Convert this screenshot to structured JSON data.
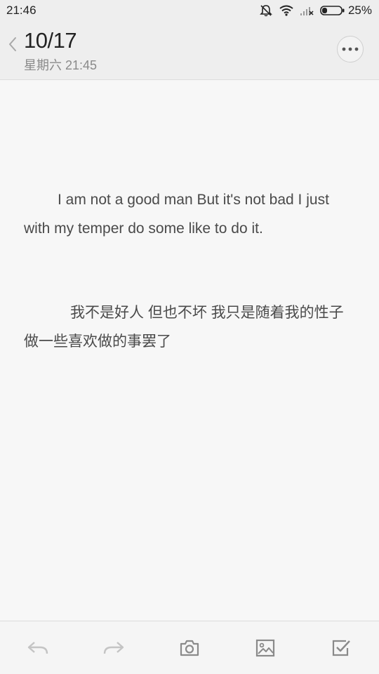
{
  "status_bar": {
    "time": "21:46",
    "battery_percent": "25%",
    "battery_level": 0.25,
    "icons": [
      "dnd-icon",
      "wifi-icon",
      "signal-icon",
      "battery-icon"
    ]
  },
  "header": {
    "title": "10/17",
    "meta": "星期六 21:45",
    "back_icon": "chevron-left-icon",
    "more_icon": "more-icon"
  },
  "note": {
    "paragraph_en": "I am not a good man But it's not bad I just with my temper do some like to do it.",
    "paragraph_zh": "我不是好人 但也不坏 我只是随着我的性子做一些喜欢做的事罢了"
  },
  "toolbar": {
    "items": [
      "undo-icon",
      "redo-icon",
      "camera-icon",
      "image-icon",
      "checkbox-icon"
    ]
  },
  "colors": {
    "background": "#f7f7f7",
    "bar_background": "#eeeeee",
    "text": "#4a4a4a",
    "muted": "#8a8a8a",
    "icon": "#9a9a9a"
  }
}
